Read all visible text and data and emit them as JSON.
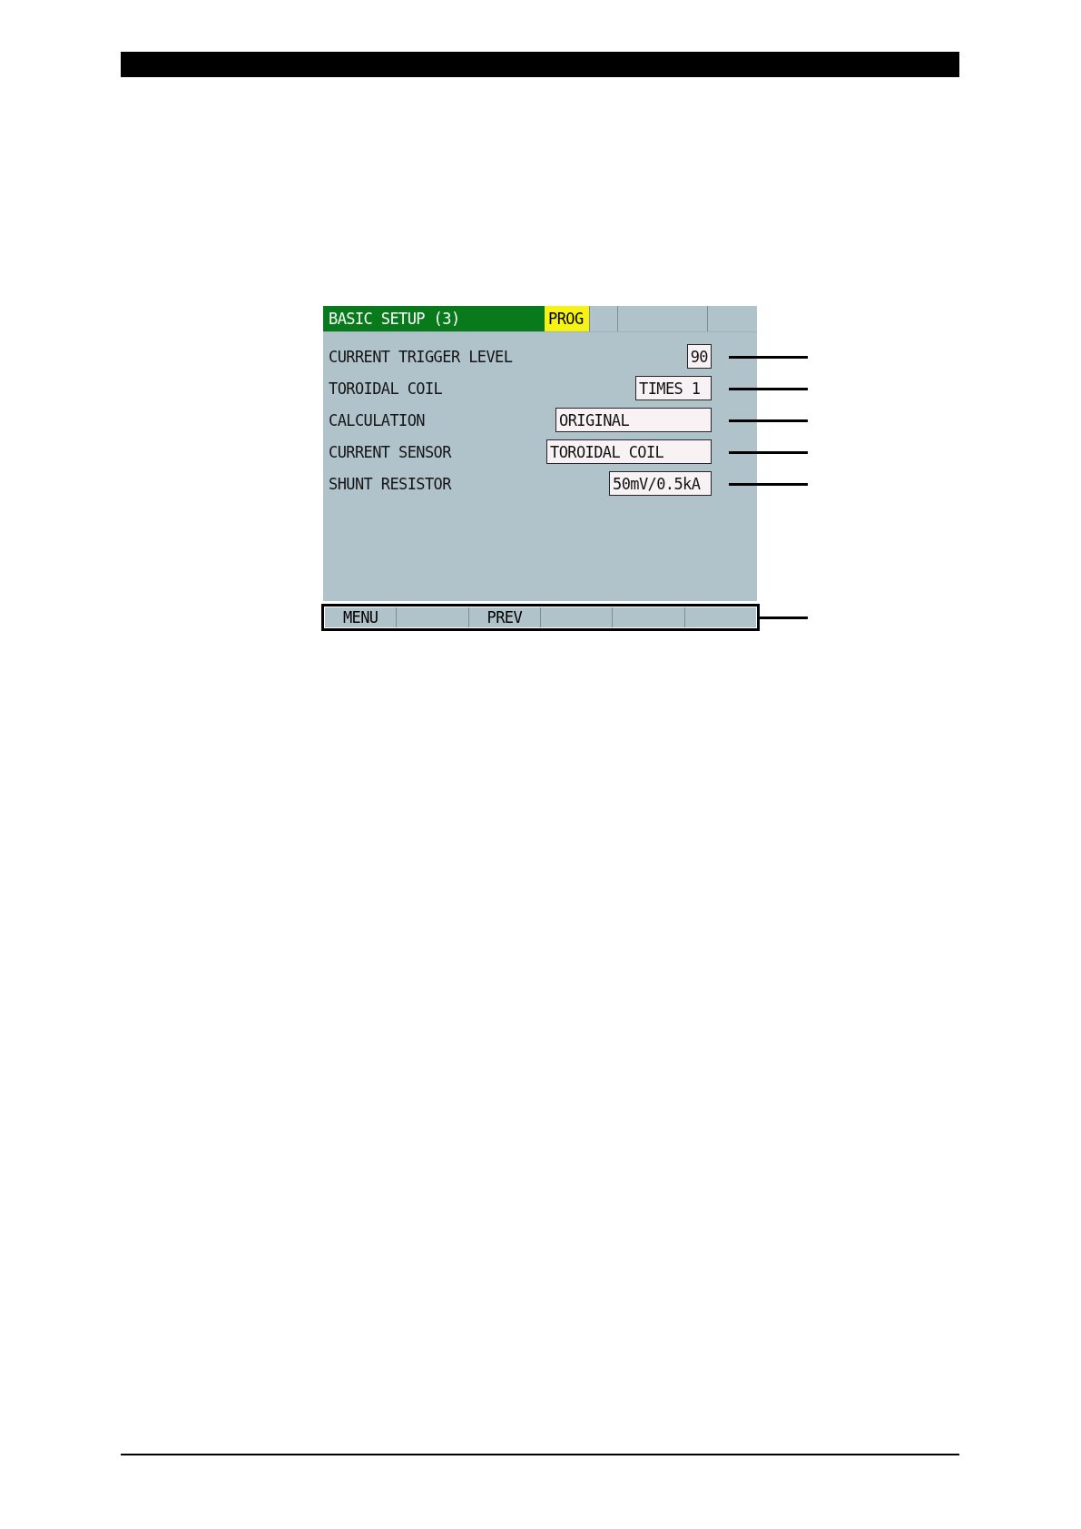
{
  "screen": {
    "title": "BASIC SETUP (3)",
    "mode": "PROG",
    "settings": [
      {
        "label": "CURRENT TRIGGER LEVEL",
        "value": "90"
      },
      {
        "label": "TOROIDAL COIL",
        "value": "TIMES 1"
      },
      {
        "label": "CALCULATION",
        "value": "ORIGINAL"
      },
      {
        "label": "CURRENT SENSOR",
        "value": "TOROIDAL COIL"
      },
      {
        "label": "SHUNT RESISTOR",
        "value": "50mV/0.5kA"
      }
    ],
    "softkeys": [
      {
        "kind": "labeled",
        "label": "MENU"
      },
      {
        "kind": "blank"
      },
      {
        "kind": "labeled",
        "label": "PREV"
      },
      {
        "kind": "blank"
      },
      {
        "kind": "blank"
      },
      {
        "kind": "blank"
      }
    ]
  }
}
